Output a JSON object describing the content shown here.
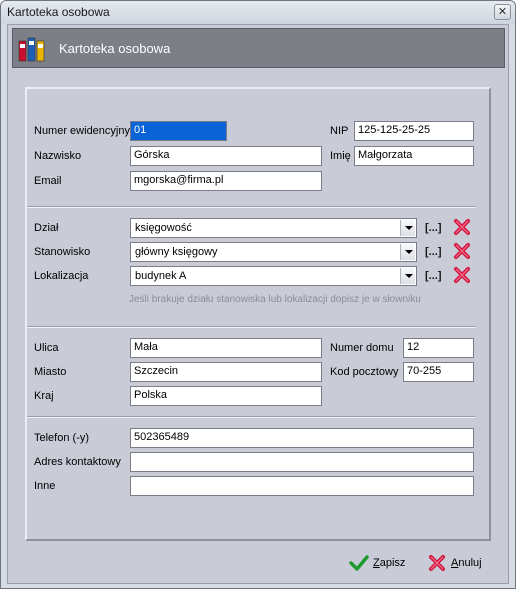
{
  "window": {
    "title": "Kartoteka osobowa",
    "close_glyph": "✕"
  },
  "header": {
    "title": "Kartoteka osobowa",
    "icon": "folders-icon"
  },
  "fields": {
    "numer_ewidencyjny": {
      "label": "Numer ewidencyjny",
      "value": "01"
    },
    "nip": {
      "label": "NIP",
      "value": "125-125-25-25"
    },
    "nazwisko": {
      "label": "Nazwisko",
      "value": "Górska"
    },
    "imie": {
      "label": "Imię",
      "value": "Małgorzata"
    },
    "email": {
      "label": "Email",
      "value": "mgorska@firma.pl"
    },
    "dzial": {
      "label": "Dział",
      "value": "księgowość"
    },
    "stanowisko": {
      "label": "Stanowisko",
      "value": "główny księgowy"
    },
    "lokalizacja": {
      "label": "Lokalizacja",
      "value": "budynek A"
    },
    "ulica": {
      "label": "Ulica",
      "value": "Mała"
    },
    "numer_domu": {
      "label": "Numer domu",
      "value": "12"
    },
    "miasto": {
      "label": "Miasto",
      "value": "Szczecin"
    },
    "kod_pocztowy": {
      "label": "Kod pocztowy",
      "value": "70-255"
    },
    "kraj": {
      "label": "Kraj",
      "value": "Polska"
    },
    "telefon": {
      "label": "Telefon (-y)",
      "value": "502365489"
    },
    "adres_kontaktowy": {
      "label": "Adres kontaktowy",
      "value": ""
    },
    "inne": {
      "label": "Inne",
      "value": ""
    }
  },
  "browse_label": "[...]",
  "hint": "Jeśli brakuje działu stanowiska lub lokalizacji dopisz je w słowniku",
  "buttons": {
    "save": "Zapisz",
    "cancel": "Anuluj"
  },
  "colors": {
    "header_bg": "#7d7f86",
    "client_bg": "#c9cbd6",
    "delete_red": "#d0103a",
    "save_green": "#1f9a2e",
    "selection_blue": "#0a64d8"
  }
}
